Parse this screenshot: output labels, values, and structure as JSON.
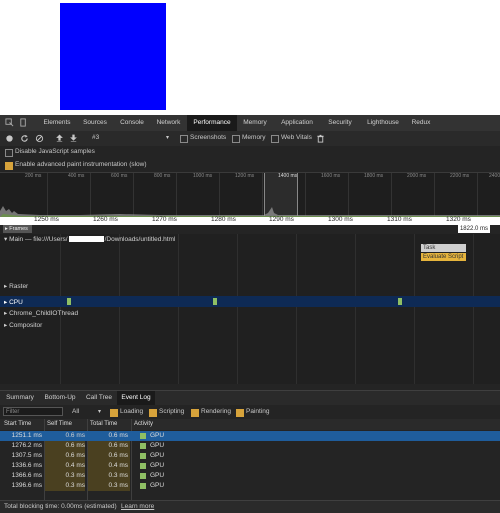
{
  "devtools": {
    "tabs": [
      "Elements",
      "Sources",
      "Console",
      "Network",
      "Performance",
      "Memory",
      "Application",
      "Security",
      "Lighthouse",
      "Redux"
    ],
    "active_tab": "Performance",
    "toolbar": {
      "profile_select": "#3",
      "screenshots_label": "Screenshots",
      "memory_label": "Memory",
      "web_vitals_label": "Web Vitals",
      "screenshots_checked": false,
      "memory_checked": false,
      "web_vitals_checked": false
    },
    "disable_js_samples_label": "Disable JavaScript samples",
    "disable_js_samples_checked": false,
    "advanced_paint_label": "Enable advanced paint instrumentation (slow)",
    "advanced_paint_checked": true
  },
  "overview": {
    "ticks": [
      "200 ms",
      "400 ms",
      "600 ms",
      "800 ms",
      "1000 ms",
      "1200 ms",
      "1400 ms",
      "1600 ms",
      "1800 ms",
      "2000 ms",
      "2200 ms",
      "2400"
    ]
  },
  "ruler": {
    "labels": [
      "1250 ms",
      "1260 ms",
      "1270 ms",
      "1280 ms",
      "1290 ms",
      "1300 ms",
      "1310 ms",
      "1320 ms"
    ]
  },
  "frames": {
    "label": "Frames",
    "duration": "1822.0 ms"
  },
  "tracks": {
    "main_prefix": "Main — file:///Users/",
    "main_suffix": "/Downloads/untitled.html",
    "raster": "Raster",
    "cpu": "CPU",
    "chrome_child": "Chrome_ChildIOThread",
    "compositor": "Compositor",
    "task": "Task",
    "evaluate_script": "Evaluate Script"
  },
  "bottom": {
    "tabs": [
      "Summary",
      "Bottom-Up",
      "Call Tree",
      "Event Log"
    ],
    "active_tab": "Event Log",
    "filter_placeholder": "Filter",
    "all_select": "All",
    "categories": [
      {
        "label": "Loading",
        "checked": true
      },
      {
        "label": "Scripting",
        "checked": true
      },
      {
        "label": "Rendering",
        "checked": true
      },
      {
        "label": "Painting",
        "checked": true
      }
    ],
    "columns": [
      "Start Time",
      "Self Time",
      "Total Time",
      "Activity"
    ],
    "rows": [
      {
        "start": "1251.1 ms",
        "self": "0.6 ms",
        "total": "0.6 ms",
        "activity": "GPU",
        "selected": true
      },
      {
        "start": "1276.2 ms",
        "self": "0.6 ms",
        "total": "0.6 ms",
        "activity": "GPU",
        "selected": false
      },
      {
        "start": "1307.5 ms",
        "self": "0.6 ms",
        "total": "0.6 ms",
        "activity": "GPU",
        "selected": false
      },
      {
        "start": "1336.6 ms",
        "self": "0.4 ms",
        "total": "0.4 ms",
        "activity": "GPU",
        "selected": false
      },
      {
        "start": "1366.6 ms",
        "self": "0.3 ms",
        "total": "0.3 ms",
        "activity": "GPU",
        "selected": false
      },
      {
        "start": "1396.6 ms",
        "self": "0.3 ms",
        "total": "0.3 ms",
        "activity": "GPU",
        "selected": false
      }
    ],
    "status_text": "Total blocking time: 0.00ms (estimated)",
    "learn_more": "Learn more"
  },
  "colors": {
    "page_box": "#0000ff",
    "gpu": "#8fbf64",
    "selection": "#1f5d9c",
    "accent_checkbox": "#d7a33b"
  }
}
